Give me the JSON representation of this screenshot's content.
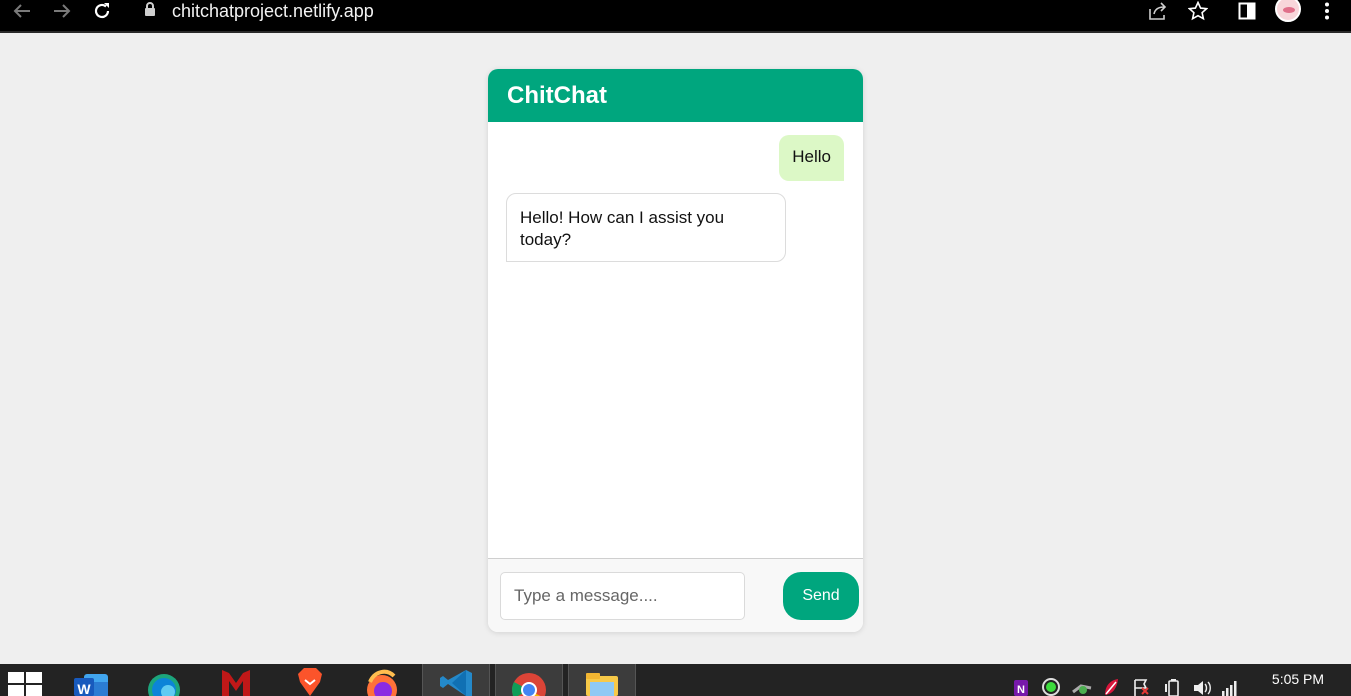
{
  "browser": {
    "url": "chitchatproject.netlify.app",
    "icons": [
      "back-arrow-icon",
      "forward-arrow-icon",
      "reload-icon",
      "lock-icon",
      "share-icon",
      "star-icon",
      "side-panel-icon",
      "profile-avatar",
      "menu-dots-icon"
    ]
  },
  "chat": {
    "title": "ChitChat",
    "messages": [
      {
        "sender": "user",
        "text": "Hello"
      },
      {
        "sender": "bot",
        "text": "Hello! How can I assist you today?"
      }
    ],
    "input_placeholder": "Type a message....",
    "send_label": "Send",
    "colors": {
      "accent": "#00a67e",
      "user_bubble": "#dcf8c6",
      "background": "#efefef"
    }
  },
  "taskbar": {
    "apps": [
      "windows-start-icon",
      "word-icon",
      "edge-icon",
      "mcafee-icon",
      "brave-icon",
      "firefox-icon",
      "vscode-icon",
      "chrome-icon",
      "file-explorer-icon"
    ],
    "tray_icons": [
      "onenote-icon",
      "recording-icon",
      "vpn-network-icon",
      "leaf-app-icon",
      "flag-icon",
      "battery-icon",
      "volume-icon",
      "wifi-signal-icon"
    ],
    "time": "5:05 PM"
  }
}
